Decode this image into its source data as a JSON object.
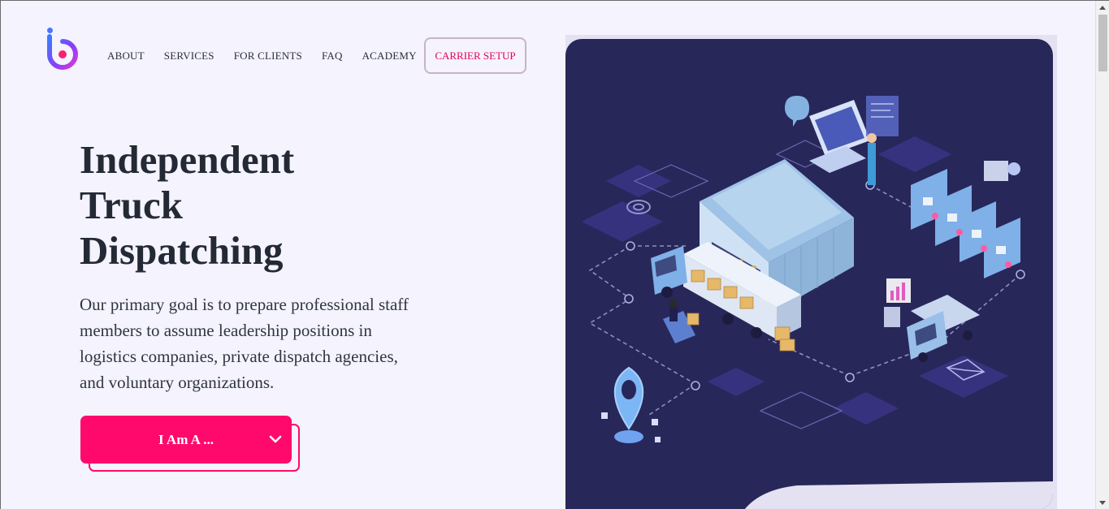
{
  "nav": {
    "items": [
      {
        "label": "ABOUT"
      },
      {
        "label": "SERVICES"
      },
      {
        "label": "FOR CLIENTS"
      },
      {
        "label": "FAQ"
      },
      {
        "label": "ACADEMY"
      }
    ],
    "cta_label": "CARRIER SETUP"
  },
  "hero": {
    "title_lines": [
      "Independent",
      "Truck",
      "Dispatching"
    ],
    "text_lines": [
      "Our primary goal is to prepare professional staff",
      "members to assume leadership positions in",
      "logistics companies, private dispatch agencies,",
      "and voluntary organizations."
    ],
    "dropdown_label": "I Am A ..."
  },
  "colors": {
    "accent": "#ff0a6c",
    "background": "#f4f3fe",
    "illustration_bg": "#28275a"
  },
  "icons": {
    "logo": "logo-icon",
    "dropdown": "chevron-down-icon"
  }
}
